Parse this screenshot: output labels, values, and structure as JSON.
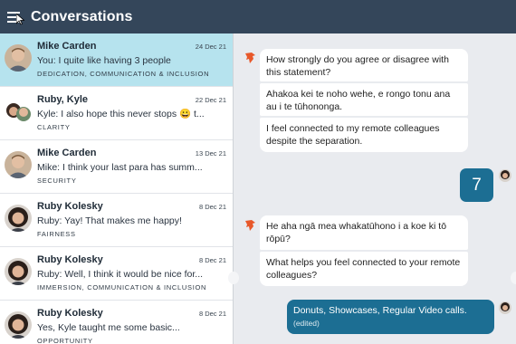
{
  "header": {
    "title": "Conversations",
    "menu_icon": "hamburger-icon"
  },
  "conversations": [
    {
      "name": "Mike Carden",
      "date": "24 Dec 21",
      "preview": "You: I quite like having 3 people",
      "tags": "DEDICATION, COMMUNICATION & INCLUSION",
      "active": true,
      "avatar": "mike"
    },
    {
      "name": "Ruby, Kyle",
      "date": "22 Dec 21",
      "preview": "Kyle: I also hope this never stops 😀 t...",
      "tags": "CLARITY",
      "active": false,
      "avatar": "group"
    },
    {
      "name": "Mike Carden",
      "date": "13 Dec 21",
      "preview": "Mike: I think your last para has summ...",
      "tags": "SECURITY",
      "active": false,
      "avatar": "mike"
    },
    {
      "name": "Ruby Kolesky",
      "date": "8 Dec 21",
      "preview": "Ruby: Yay! That makes me happy!",
      "tags": "FAIRNESS",
      "active": false,
      "avatar": "ruby"
    },
    {
      "name": "Ruby Kolesky",
      "date": "8 Dec 21",
      "preview": "Ruby: Well, I think it would be nice for...",
      "tags": "IMMERSION, COMMUNICATION & INCLUSION",
      "active": false,
      "avatar": "ruby"
    },
    {
      "name": "Ruby Kolesky",
      "date": "8 Dec 21",
      "preview": "Yes, Kyle taught me some basic...",
      "tags": "OPPORTUNITY",
      "active": false,
      "avatar": "ruby"
    }
  ],
  "chat": {
    "q1_prompt": "How strongly do you agree or disagree with this statement?",
    "q1_maori": "Ahakoa kei te noho wehe, e rongo tonu ana au i te tūhononga.",
    "q1_statement": "I feel connected to my remote colleagues despite the separation.",
    "answer_rating": "7",
    "q2_maori": "He aha ngā mea whakatūhono i a koe ki tō rōpū?",
    "q2_english": "What helps you feel connected to your remote colleagues?",
    "reply_text": "Donuts, Showcases, Regular Video calls.",
    "reply_status": "(edited)"
  },
  "colors": {
    "header_bg": "#34465a",
    "active_row": "#b6e3ee",
    "accent": "#1c6e93",
    "logo": "#e8582a"
  }
}
